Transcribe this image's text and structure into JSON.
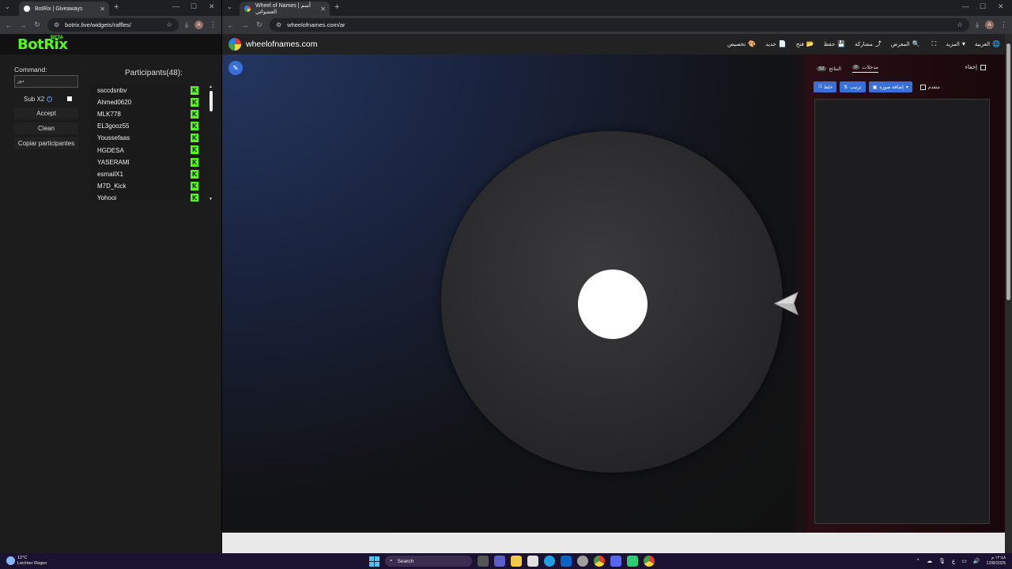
{
  "left_browser": {
    "tab_title": "BotRix | Giveaways",
    "url": "botrix.live/widgets/raffles/",
    "avatar_letter": "A"
  },
  "right_browser": {
    "tab_title": "Wheel of Names | أسم العشوائي",
    "url": "wheelofnames.com/ar",
    "avatar_letter": "A"
  },
  "botrix": {
    "logo": "BotRix",
    "beta": "BETA",
    "command_label": "Command:",
    "command_value": "دور",
    "sub_label": "Sub X2",
    "accept": "Accept",
    "clean": "Clean",
    "copy": "Copiar participantes",
    "participants_title": "Participants(48):",
    "participants": [
      "ssccdsnbv",
      "Ahmed0620",
      "MLK778",
      "EL3gooz55",
      "Youssefaas",
      "HGDESA",
      "YASERAMI",
      "esmailX1",
      "M7D_Kick",
      "Yohooi"
    ],
    "kick_glyph": "K",
    "accent": "#53fc18"
  },
  "won": {
    "site_title": "wheelofnames.com",
    "menu": [
      {
        "label": "العربية",
        "icon": "🌐"
      },
      {
        "label": "المزيد",
        "icon": "▾"
      },
      {
        "label": "",
        "icon": "⛶"
      },
      {
        "label": "المعرض",
        "icon": "🔍"
      },
      {
        "label": "مشاركة",
        "icon": "⤴"
      },
      {
        "label": "حفظ",
        "icon": "💾"
      },
      {
        "label": "فتح",
        "icon": "📂"
      },
      {
        "label": "جديد",
        "icon": "📄"
      },
      {
        "label": "تخصيص",
        "icon": "🎨"
      }
    ],
    "hide_label": "إخفاء",
    "tabs": [
      {
        "label": "مدخلات",
        "count": "0"
      },
      {
        "label": "النتائج",
        "count": "52"
      }
    ],
    "tools": {
      "shuffle": "خلط",
      "sort": "ترتيب",
      "add_image": "إضافة صورة",
      "advanced": "متقدم"
    },
    "accent": "#3b6fd8"
  },
  "taskbar": {
    "temp": "12°C",
    "weather": "Leichter Regen",
    "search": "Search",
    "time": "١٢:٤٨ م",
    "date": "12/8/2025"
  }
}
